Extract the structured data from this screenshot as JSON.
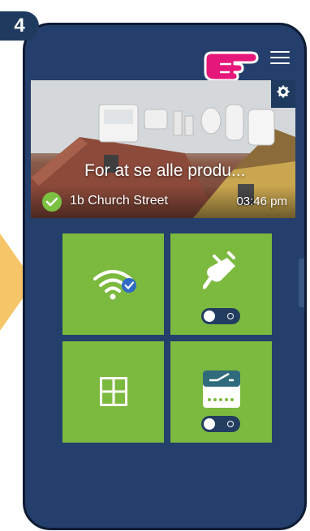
{
  "step": {
    "number": "4"
  },
  "banner": {
    "title": "For at se alle produ...",
    "address": "1b Church Street",
    "time": "03:46 pm"
  },
  "tiles": [
    {
      "name": "wifi-tile",
      "icon": "wifi-icon"
    },
    {
      "name": "plug-tile",
      "icon": "plug-icon",
      "toggle_on": false
    },
    {
      "name": "window-tile",
      "icon": "window-icon"
    },
    {
      "name": "switch-tile",
      "icon": "wall-switch-icon",
      "toggle_on": false
    }
  ],
  "colors": {
    "background": "#243f6b",
    "tile": "#7cb93f",
    "accent_arrow": "#f6c567",
    "hand_pointer": "#e6177a",
    "badge": "#1f3a5f"
  }
}
